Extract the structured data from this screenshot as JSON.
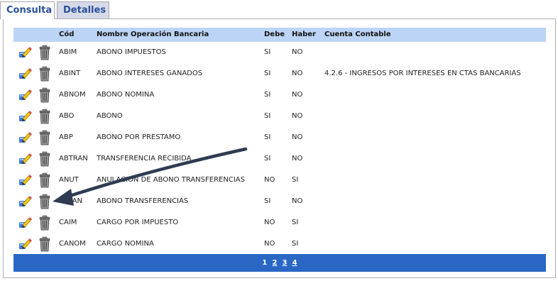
{
  "tabs": [
    {
      "label": "Consulta",
      "active": true
    },
    {
      "label": "Detalles",
      "active": false
    }
  ],
  "table": {
    "headers": {
      "cod": "Cód",
      "nombre": "Nombre Operación Bancaria",
      "debe": "Debe",
      "haber": "Haber",
      "cuenta": "Cuenta Contable"
    },
    "rows": [
      {
        "cod": "ABIM",
        "nombre": "ABONO IMPUESTOS",
        "debe": "SI",
        "haber": "NO",
        "cuenta": ""
      },
      {
        "cod": "ABINT",
        "nombre": "ABONO INTERESES GANADOS",
        "debe": "SI",
        "haber": "NO",
        "cuenta": "4.2.6 - INGRESOS POR INTERESES EN CTAS BANCARIAS"
      },
      {
        "cod": "ABNOM",
        "nombre": "ABONO NOMINA",
        "debe": "SI",
        "haber": "NO",
        "cuenta": ""
      },
      {
        "cod": "ABO",
        "nombre": "ABONO",
        "debe": "SI",
        "haber": "NO",
        "cuenta": ""
      },
      {
        "cod": "ABP",
        "nombre": "ABONO POR PRESTAMO",
        "debe": "SI",
        "haber": "NO",
        "cuenta": ""
      },
      {
        "cod": "ABTRAN",
        "nombre": "TRANSFERENCIA RECIBIDA",
        "debe": "SI",
        "haber": "NO",
        "cuenta": ""
      },
      {
        "cod": "ANUT",
        "nombre": "ANULACION DE ABONO TRANSFERENCIAS",
        "debe": "NO",
        "haber": "SI",
        "cuenta": ""
      },
      {
        "cod": "ATRAN",
        "nombre": "ABONO TRANSFERENCIAS",
        "debe": "SI",
        "haber": "NO",
        "cuenta": ""
      },
      {
        "cod": "CAIM",
        "nombre": "CARGO POR IMPUESTO",
        "debe": "NO",
        "haber": "SI",
        "cuenta": ""
      },
      {
        "cod": "CANOM",
        "nombre": "CARGO NOMINA",
        "debe": "NO",
        "haber": "SI",
        "cuenta": ""
      }
    ],
    "row_icons": [
      "edit-icon",
      "trash-icon"
    ]
  },
  "pager": {
    "pages": [
      "1",
      "2",
      "3",
      "4"
    ],
    "current": "1"
  },
  "colors": {
    "header_bg": "#bcd4f5",
    "pager_bg": "#2a67c5",
    "tab_text": "#2a4f9a",
    "arrow": "#2f3b52"
  }
}
